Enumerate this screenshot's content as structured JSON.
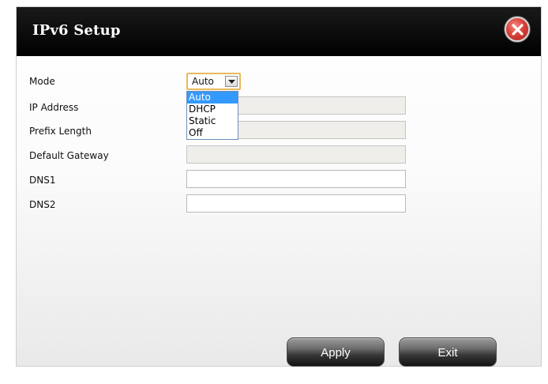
{
  "dialog": {
    "title": "IPv6 Setup",
    "close_icon": "close-icon"
  },
  "form": {
    "mode": {
      "label": "Mode",
      "value": "Auto",
      "options": [
        "Auto",
        "DHCP",
        "Static",
        "Off"
      ],
      "highlighted": "Auto"
    },
    "ip_address": {
      "label": "IP Address",
      "value": "",
      "disabled": true
    },
    "prefix_length": {
      "label": "Prefix Length",
      "value": "",
      "disabled": true
    },
    "default_gateway": {
      "label": "Default Gateway",
      "value": "",
      "disabled": true
    },
    "dns1": {
      "label": "DNS1",
      "value": ""
    },
    "dns2": {
      "label": "DNS2",
      "value": ""
    }
  },
  "buttons": {
    "apply": "Apply",
    "exit": "Exit"
  },
  "colors": {
    "titlebar": "#000000",
    "close_button": "#d9413a",
    "dropdown_highlight": "#3399ff",
    "select_border": "#e9b85c"
  }
}
